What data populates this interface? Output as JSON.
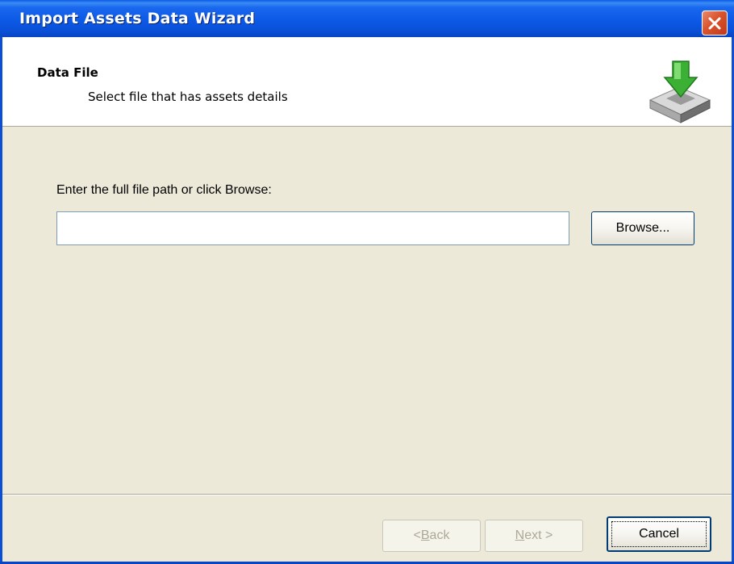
{
  "window": {
    "title": "Import Assets Data Wizard"
  },
  "header": {
    "title": "Data File",
    "subtitle": "Select file that has assets details",
    "icon": "import-tray-arrow-icon"
  },
  "form": {
    "prompt": "Enter the full file path or click Browse:",
    "file_path_value": "",
    "browse_label": "Browse..."
  },
  "footer": {
    "back_key": "B",
    "back_rest": "ack",
    "back_prefix": "< ",
    "next_key": "N",
    "next_rest": "ext >",
    "cancel_label": "Cancel"
  },
  "colors": {
    "titlebar": "#0a4fd6",
    "close_button": "#d9532c",
    "client_bg": "#ece9d8",
    "header_bg": "#ffffff",
    "icon_arrow": "#3cb035"
  }
}
